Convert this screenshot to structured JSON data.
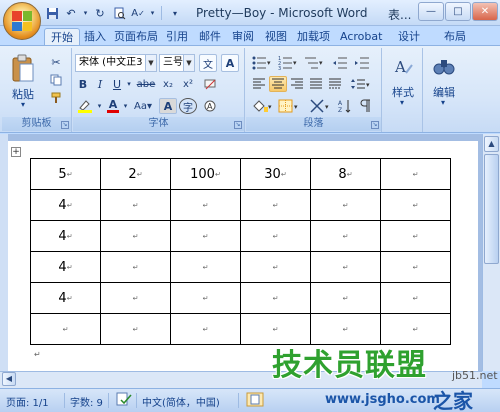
{
  "window": {
    "title": "Pretty—Boy - Microsoft Word",
    "title_extra": "表..."
  },
  "quick_access": [
    "save-icon",
    "undo-icon",
    "redo-icon",
    "print-preview-icon",
    "spelling-icon",
    "customize-icon"
  ],
  "tabs": [
    "开始",
    "插入",
    "页面布局",
    "引用",
    "邮件",
    "审阅",
    "视图",
    "加载项",
    "Acrobat",
    "设计",
    "布局"
  ],
  "ribbon": {
    "clipboard": {
      "label": "剪贴板",
      "paste": "粘贴"
    },
    "font": {
      "label": "字体",
      "font_name": "宋体 (中文正3",
      "font_size": "三号",
      "bold": "B",
      "italic": "I",
      "underline": "U",
      "strike": "abe",
      "subscript": "x₂",
      "superscript": "x²",
      "case": "Aa",
      "char_border": "A",
      "enclose": "字",
      "phonetic": "文",
      "grow": "A"
    },
    "paragraph": {
      "label": "段落"
    },
    "styles": {
      "label": "样式"
    },
    "editing": {
      "label": "编辑"
    }
  },
  "table": {
    "rows": [
      [
        "5",
        "2",
        "100",
        "30",
        "8",
        ""
      ],
      [
        "4",
        "",
        "",
        "",
        "",
        ""
      ],
      [
        "4",
        "",
        "",
        "",
        "",
        ""
      ],
      [
        "4",
        "",
        "",
        "",
        "",
        ""
      ],
      [
        "4",
        "",
        "",
        "",
        "",
        ""
      ],
      [
        "",
        "",
        "",
        "",
        "",
        ""
      ]
    ]
  },
  "status": {
    "page": "页面: 1/1",
    "words": "字数: 9",
    "language": "中文(简体，中国)"
  },
  "watermark": {
    "main": "技术员联盟",
    "site": "jb51.net",
    "url": "www.jsgho.com",
    "zj": "之家"
  },
  "colors": {
    "ribbon_bg": "#d7e6f9",
    "watermark_green": "#2fa12f",
    "font_color_red": "#e00000",
    "highlight_yellow": "#ffff00"
  }
}
